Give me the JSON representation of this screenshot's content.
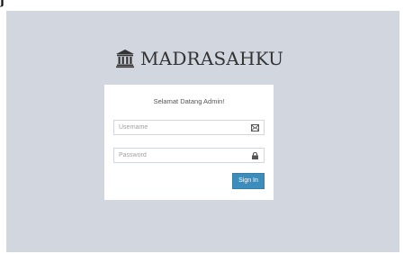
{
  "app": {
    "logo_text": "MADRASAHKU",
    "logo_icon": "bank-icon",
    "top_fragment": "j"
  },
  "login": {
    "greeting": "Selamat Datang Admin!",
    "username": {
      "value": "",
      "placeholder": "Username",
      "icon": "envelope-icon"
    },
    "password": {
      "value": "",
      "placeholder": "Password",
      "icon": "lock-icon"
    },
    "signin_label": "Sign In"
  },
  "colors": {
    "background": "#d2d6de",
    "box": "#ffffff",
    "primary_button": "#3c8dbc",
    "border": "#d2d6de"
  }
}
